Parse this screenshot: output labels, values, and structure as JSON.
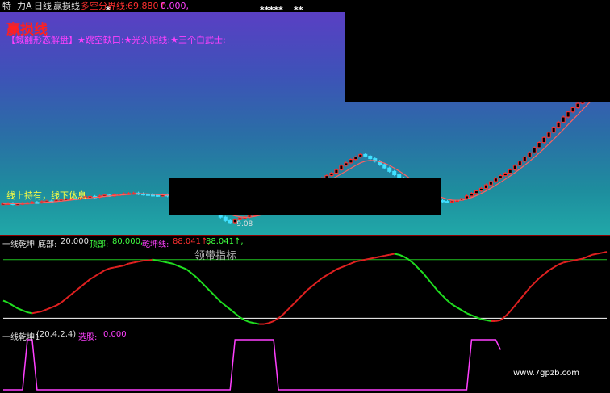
{
  "topbar": {
    "item1": "特",
    "item2": "力A",
    "item3": "日线",
    "item4": "赢损线",
    "indicator": "多空分界线:",
    "indicator_value": "69.880↑",
    "indicator_value2": "0.000,",
    "stars1": "*",
    "stars2": "*****",
    "stars3": "**"
  },
  "main": {
    "title": "赢损线",
    "pattern_text": "【蜮翻形态解盘】★跳空缺口:★光头阳线:★三个白武士:",
    "hold_text": "线上持有，线下休息",
    "low_price_label": "9.08"
  },
  "panel2": {
    "name": "一线乾坤",
    "bottom_label": "底部:",
    "bottom_value": "20.000,",
    "top_label": "顶部:",
    "top_value": "80.000,",
    "line_label": "乾坤线:",
    "line_value1": "88.041↑,",
    "line_value2": "88.041↑,",
    "watermark": "领带指标"
  },
  "panel3": {
    "name": "一线乾坤1",
    "params": "(20,4,2,4)",
    "select_label": "选股:",
    "select_value": "0.000",
    "site": "www.7gpzb.com"
  },
  "colors": {
    "up": "#ff3030",
    "down": "#40e0ff",
    "flat": "#ffffff",
    "ma": "#ff6060",
    "rise_line": "#e02020",
    "fall_line": "#20e020",
    "top_line": "#20c020",
    "bottom_line": "#ffffff",
    "select_line": "#ff40ff"
  },
  "chart_data": [
    {
      "type": "candlestick",
      "title": "赢损线",
      "x": [
        0,
        1,
        2,
        3,
        4,
        5,
        6,
        7,
        8,
        9,
        10,
        11,
        12,
        13,
        14,
        15,
        16,
        17,
        18,
        19,
        20,
        21,
        22,
        23,
        24,
        25,
        26,
        27,
        28,
        29,
        30,
        31,
        32,
        33,
        34,
        35,
        36,
        37,
        38,
        39,
        40,
        41,
        42,
        43,
        44,
        45,
        46,
        47,
        48,
        49,
        50,
        51,
        52,
        53,
        54,
        55,
        56,
        57,
        58,
        59,
        60,
        61,
        62,
        63,
        64,
        65,
        66,
        67,
        68,
        69,
        70,
        71,
        72,
        73,
        74,
        75,
        76,
        77,
        78,
        79,
        80,
        81,
        82,
        83,
        84,
        85,
        86,
        87,
        88,
        89,
        90,
        91,
        92,
        93,
        94,
        95,
        96,
        97,
        98,
        99,
        100,
        101,
        102,
        103,
        104,
        105,
        106,
        107,
        108,
        109,
        110,
        111,
        112,
        113,
        114,
        115,
        116,
        117,
        118,
        119,
        120,
        121,
        122,
        123,
        124,
        125
      ],
      "close": [
        10.2,
        10.22,
        10.18,
        10.19,
        10.23,
        10.25,
        10.28,
        10.27,
        10.32,
        10.35,
        10.33,
        10.4,
        10.42,
        10.45,
        10.5,
        10.48,
        10.55,
        10.6,
        10.62,
        10.58,
        10.65,
        10.7,
        10.68,
        10.72,
        10.75,
        10.78,
        10.8,
        10.82,
        10.78,
        10.75,
        10.72,
        10.7,
        10.68,
        10.72,
        10.66,
        10.6,
        10.58,
        10.55,
        10.5,
        10.45,
        10.4,
        10.3,
        10.1,
        9.95,
        9.8,
        9.4,
        9.2,
        9.08,
        9.25,
        9.35,
        9.4,
        9.5,
        9.62,
        9.7,
        9.85,
        10.0,
        10.2,
        10.4,
        10.6,
        10.8,
        10.95,
        11.1,
        11.25,
        11.3,
        11.45,
        11.6,
        11.7,
        11.85,
        12.0,
        12.2,
        12.45,
        12.6,
        12.8,
        12.95,
        13.1,
        13.0,
        12.85,
        12.7,
        12.5,
        12.3,
        12.1,
        11.9,
        11.7,
        11.45,
        11.2,
        11.0,
        10.85,
        10.7,
        10.55,
        10.45,
        10.38,
        10.33,
        10.3,
        10.35,
        10.4,
        10.5,
        10.65,
        10.8,
        10.95,
        11.1,
        11.3,
        11.5,
        11.7,
        11.85,
        12.0,
        12.2,
        12.45,
        12.7,
        12.95,
        13.2,
        13.5,
        13.8,
        14.1,
        14.4,
        14.7,
        15.0,
        15.3,
        15.6,
        15.85,
        16.1,
        16.35,
        16.6,
        16.85,
        17.1,
        17.35,
        17.6
      ],
      "ma": [
        10.2,
        10.21,
        10.2,
        10.2,
        10.21,
        10.22,
        10.23,
        10.24,
        10.26,
        10.28,
        10.3,
        10.32,
        10.35,
        10.38,
        10.41,
        10.44,
        10.47,
        10.51,
        10.54,
        10.57,
        10.59,
        10.62,
        10.65,
        10.68,
        10.7,
        10.72,
        10.75,
        10.77,
        10.78,
        10.78,
        10.77,
        10.75,
        10.73,
        10.72,
        10.7,
        10.67,
        10.63,
        10.59,
        10.55,
        10.5,
        10.44,
        10.37,
        10.27,
        10.16,
        10.03,
        9.88,
        9.72,
        9.57,
        9.48,
        9.42,
        9.39,
        9.4,
        9.44,
        9.5,
        9.58,
        9.68,
        9.8,
        9.95,
        10.11,
        10.28,
        10.45,
        10.62,
        10.79,
        10.94,
        11.09,
        11.23,
        11.36,
        11.5,
        11.64,
        11.79,
        11.95,
        12.11,
        12.28,
        12.45,
        12.6,
        12.7,
        12.74,
        12.73,
        12.67,
        12.58,
        12.45,
        12.29,
        12.12,
        11.93,
        11.73,
        11.52,
        11.32,
        11.13,
        10.95,
        10.79,
        10.66,
        10.55,
        10.46,
        10.41,
        10.39,
        10.41,
        10.47,
        10.56,
        10.67,
        10.8,
        10.95,
        11.11,
        11.28,
        11.46,
        11.64,
        11.83,
        12.03,
        12.24,
        12.46,
        12.69,
        12.93,
        13.18,
        13.44,
        13.71,
        13.99,
        14.27,
        14.56,
        14.86,
        15.15,
        15.44,
        15.74,
        16.03,
        16.31,
        16.59,
        16.87,
        17.14
      ],
      "low_label": "9.08"
    },
    {
      "type": "line",
      "title": "一线乾坤",
      "x": [
        0,
        1,
        2,
        3,
        4,
        5,
        6,
        7,
        8,
        9,
        10,
        11,
        12,
        13,
        14,
        15,
        16,
        17,
        18,
        19,
        20,
        21,
        22,
        23,
        24,
        25,
        26,
        27,
        28,
        29,
        30,
        31,
        32,
        33,
        34,
        35,
        36,
        37,
        38,
        39,
        40,
        41,
        42,
        43,
        44,
        45,
        46,
        47,
        48,
        49,
        50,
        51,
        52,
        53,
        54,
        55,
        56,
        57,
        58,
        59,
        60,
        61,
        62,
        63,
        64,
        65,
        66,
        67,
        68,
        69,
        70,
        71,
        72,
        73,
        74,
        75,
        76,
        77,
        78,
        79,
        80,
        81,
        82,
        83,
        84,
        85,
        86,
        87,
        88,
        89,
        90,
        91,
        92,
        93,
        94,
        95,
        96,
        97,
        98,
        99,
        100,
        101,
        102,
        103,
        104,
        105,
        106,
        107,
        108,
        109,
        110,
        111,
        112,
        113,
        114,
        115,
        116,
        117,
        118,
        119,
        120,
        121,
        122,
        123,
        124,
        125
      ],
      "values": [
        38,
        36,
        33,
        30,
        28,
        26,
        25,
        26,
        27,
        29,
        31,
        33,
        36,
        40,
        44,
        48,
        52,
        56,
        60,
        63,
        66,
        69,
        71,
        72,
        73,
        74,
        76,
        77,
        78,
        79,
        79,
        80,
        79,
        78,
        77,
        76,
        74,
        72,
        70,
        66,
        62,
        57,
        52,
        47,
        42,
        37,
        33,
        29,
        25,
        21,
        18,
        16,
        15,
        14,
        14,
        15,
        17,
        20,
        24,
        29,
        34,
        39,
        44,
        49,
        53,
        57,
        61,
        64,
        67,
        70,
        72,
        74,
        76,
        78,
        79,
        80,
        81,
        82,
        83,
        84,
        85,
        86,
        85,
        83,
        80,
        76,
        71,
        66,
        60,
        54,
        48,
        43,
        38,
        34,
        31,
        28,
        25,
        23,
        21,
        19,
        18,
        17,
        17,
        18,
        22,
        27,
        33,
        39,
        45,
        51,
        56,
        61,
        65,
        69,
        72,
        75,
        77,
        78,
        79,
        80,
        81,
        83,
        85,
        86,
        87,
        88
      ],
      "ylim": [
        12,
        98
      ],
      "top": 80,
      "bottom": 20
    },
    {
      "type": "line",
      "title": "一线乾坤1",
      "x": [
        0,
        1,
        2,
        3,
        4,
        5,
        6,
        7,
        8,
        9,
        10,
        11,
        12,
        13,
        14,
        15,
        16,
        17,
        18,
        19,
        20,
        21,
        22,
        23,
        24,
        25,
        26,
        27,
        28,
        29,
        30,
        31,
        32,
        33,
        34,
        35,
        36,
        37,
        38,
        39,
        40,
        41,
        42,
        43,
        44,
        45,
        46,
        47,
        48,
        49,
        50,
        51,
        52,
        53,
        54,
        55,
        56,
        57,
        58,
        59,
        60,
        61,
        62,
        63,
        64,
        65,
        66,
        67,
        68,
        69,
        70,
        71,
        72,
        73,
        74,
        75,
        76,
        77,
        78,
        79,
        80,
        81,
        82,
        83,
        84,
        85,
        86,
        87,
        88,
        89,
        90,
        91,
        92,
        93,
        94,
        95,
        96,
        97,
        98,
        99,
        100,
        101,
        102,
        103,
        104,
        105,
        106,
        107,
        108,
        109,
        110,
        111,
        112,
        113,
        114,
        115,
        116,
        117,
        118,
        119,
        120,
        121,
        122,
        123,
        124,
        125
      ],
      "values": [
        0,
        0,
        0,
        0,
        0,
        1,
        1,
        0,
        0,
        0,
        0,
        0,
        0,
        0,
        0,
        0,
        0,
        0,
        0,
        0,
        0,
        0,
        0,
        0,
        0,
        0,
        0,
        0,
        0,
        0,
        0,
        0,
        0,
        0,
        0,
        0,
        0,
        0,
        0,
        0,
        0,
        0,
        0,
        0,
        0,
        0,
        0,
        0,
        1,
        1,
        1,
        1,
        1,
        1,
        1,
        1,
        1,
        0,
        0,
        0,
        0,
        0,
        0,
        0,
        0,
        0,
        0,
        0,
        0,
        0,
        0,
        0,
        0,
        0,
        0,
        0,
        0,
        0,
        0,
        0,
        0,
        0,
        0,
        0,
        0,
        0,
        0,
        0,
        0,
        0,
        0,
        0,
        0,
        0,
        0,
        0,
        0,
        1,
        1,
        1,
        1,
        1,
        1,
        0.8,
        null,
        null,
        null,
        null,
        null,
        null,
        null,
        null,
        null,
        null,
        null,
        null,
        null,
        null,
        null,
        null,
        null,
        null,
        null,
        null,
        null,
        null
      ],
      "ylim": [
        0,
        1
      ]
    }
  ]
}
